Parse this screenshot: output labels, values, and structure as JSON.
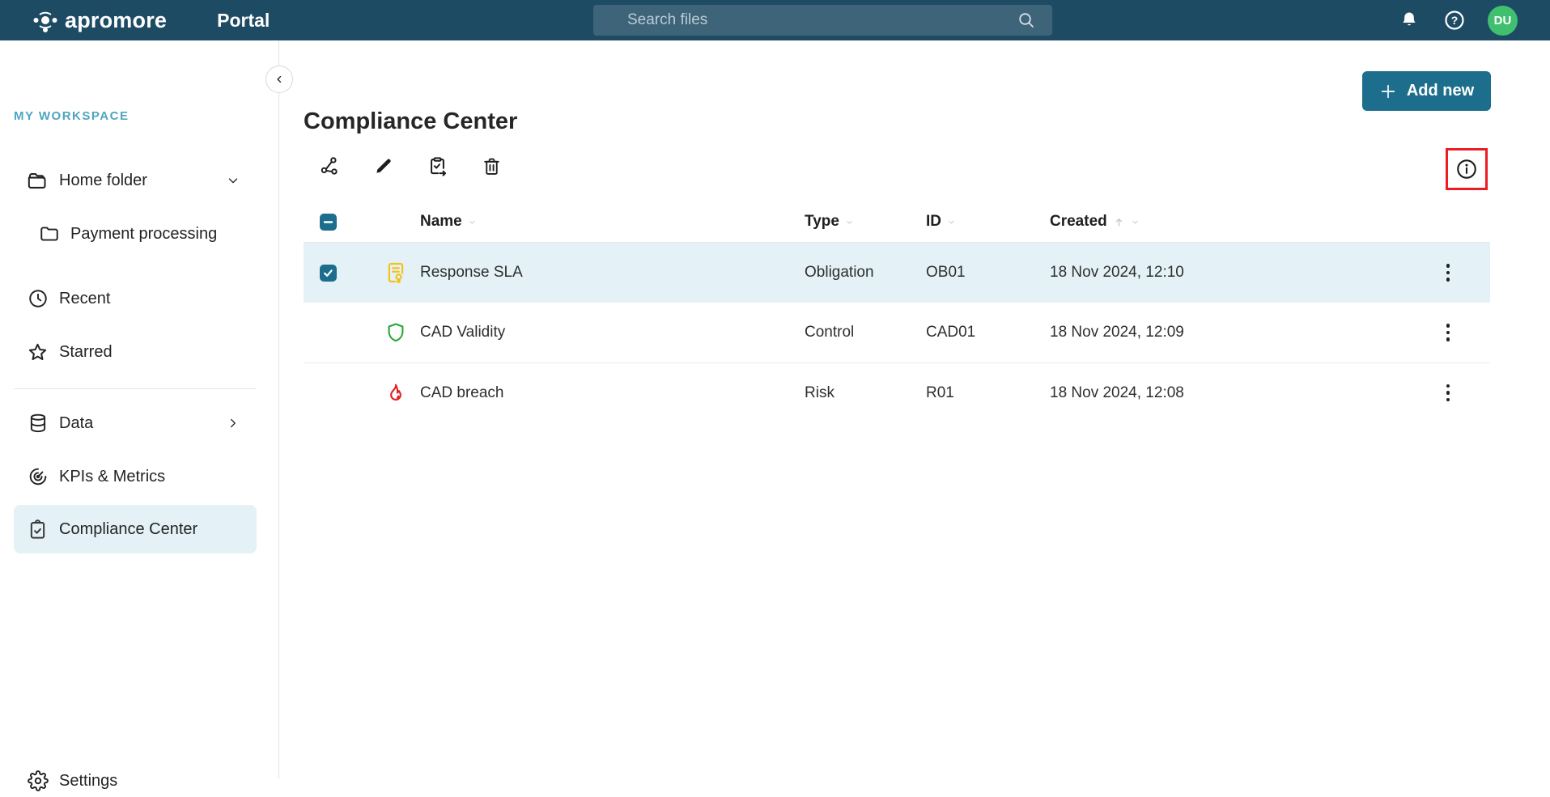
{
  "topbar": {
    "brand": "apromore",
    "product": "Portal",
    "search_placeholder": "Search files",
    "avatar_initials": "DU"
  },
  "sidebar": {
    "section_label": "MY WORKSPACE",
    "items": [
      {
        "label": "Home folder",
        "icon": "folder-icon",
        "trailing": "chevron-down"
      },
      {
        "label": "Payment processing",
        "icon": "folder-icon"
      },
      {
        "label": "Recent",
        "icon": "clock-icon"
      },
      {
        "label": "Starred",
        "icon": "star-icon"
      },
      {
        "label": "Data",
        "icon": "database-icon",
        "trailing": "chevron-right"
      },
      {
        "label": "KPIs & Metrics",
        "icon": "kpi-gauge-icon"
      },
      {
        "label": "Compliance Center",
        "icon": "clipboard-check-icon",
        "selected": true
      },
      {
        "label": "Settings",
        "icon": "gear-icon"
      }
    ]
  },
  "main": {
    "title": "Compliance Center",
    "add_new_label": "Add new",
    "toolbar_icons": [
      "share-icon",
      "edit-pencil-icon",
      "clipboard-export-icon",
      "trash-icon"
    ],
    "info_icon": "info-icon",
    "annotation": {
      "type": "highlight-box",
      "target": "info-button",
      "color": "#EC1C24"
    }
  },
  "table": {
    "headers": {
      "name": "Name",
      "type": "Type",
      "id": "ID",
      "created": "Created"
    },
    "sort": {
      "column": "Created",
      "direction": "asc"
    },
    "select_all_state": "indeterminate",
    "rows": [
      {
        "name": "Response SLA",
        "type": "Obligation",
        "id": "OB01",
        "created": "18 Nov 2024, 12:10",
        "icon": "obligation-certificate-icon",
        "selected": true
      },
      {
        "name": "CAD Validity",
        "type": "Control",
        "id": "CAD01",
        "created": "18 Nov 2024, 12:09",
        "icon": "control-shield-icon",
        "selected": false
      },
      {
        "name": "CAD breach",
        "type": "Risk",
        "id": "R01",
        "created": "18 Nov 2024, 12:08",
        "icon": "risk-flame-icon",
        "selected": false
      }
    ]
  },
  "colors": {
    "topbar": "#1E4B64",
    "accent": "#1C6E8C",
    "selected_row": "#E4F2F8",
    "avatar": "#40BF6F",
    "workspace_label": "#4FA5C1",
    "obligation": "#F5C21B",
    "control": "#27A737",
    "risk": "#E02121",
    "annotation": "#EC1C24"
  }
}
